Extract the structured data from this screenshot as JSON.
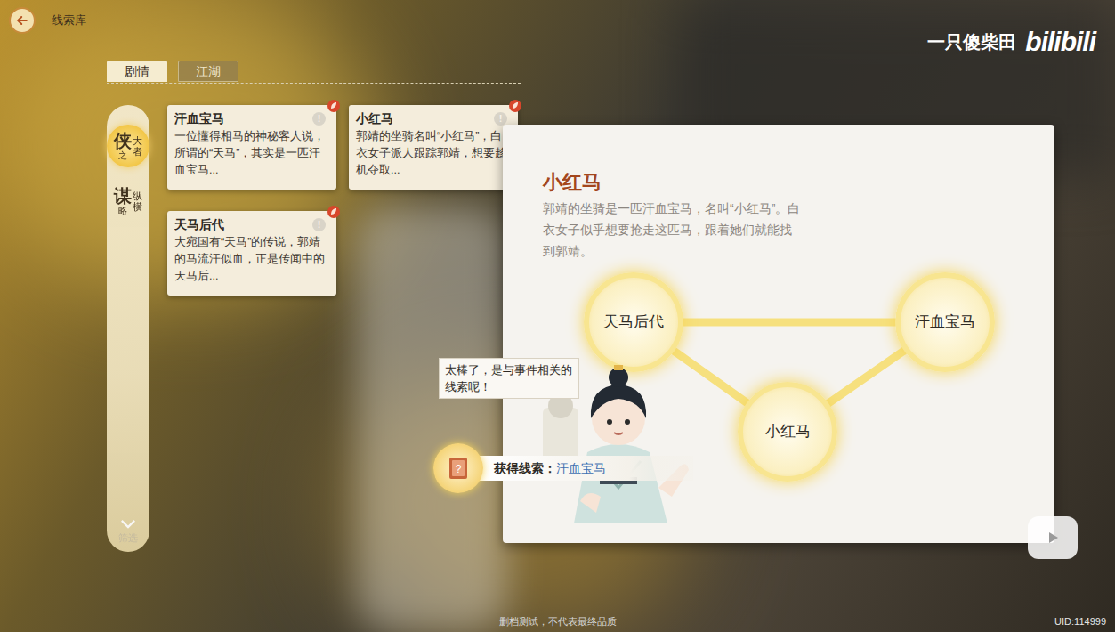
{
  "header": {
    "title": "线索库"
  },
  "watermark": {
    "author": "一只傻柴田",
    "logo": "bilibili"
  },
  "tabs": [
    {
      "label": "剧情",
      "selected": true
    },
    {
      "label": "江湖",
      "selected": false
    }
  ],
  "chapters": [
    {
      "main": "侠",
      "sub": "之",
      "side": "大者",
      "selected": true
    },
    {
      "main": "谋",
      "sub": "略",
      "side": "纵横",
      "selected": false
    }
  ],
  "filter": {
    "label": "筛选"
  },
  "clues": [
    {
      "title": "汗血宝马",
      "desc": "一位懂得相马的神秘客人说，所谓的“天马”，其实是一匹汗血宝马...",
      "new": true,
      "hint": "!"
    },
    {
      "title": "小红马",
      "desc": "郭靖的坐骑名叫“小红马”，白衣女子派人跟踪郭靖，想要趁机夺取...",
      "new": true,
      "hint": "!"
    },
    {
      "title": "天马后代",
      "desc": "大宛国有“天马”的传说，郭靖的马流汗似血，正是传闻中的天马后...",
      "new": true,
      "hint": "!"
    }
  ],
  "detail": {
    "title": "小红马",
    "desc": "郭靖的坐骑是一匹汗血宝马，名叫“小红马”。白衣女子似乎想要抢走这匹马，跟着她们就能找到郭靖。"
  },
  "graph": {
    "nodes": [
      {
        "label": "天马后代"
      },
      {
        "label": "汗血宝马"
      },
      {
        "label": "小红马"
      }
    ],
    "edges": [
      {
        "from": 0,
        "to": 1
      },
      {
        "from": 0,
        "to": 2
      },
      {
        "from": 2,
        "to": 1
      }
    ]
  },
  "guide": {
    "speech": "太棒了，是与事件相关的线索呢！"
  },
  "toast": {
    "prefix": "获得线索：",
    "clue": "汗血宝马"
  },
  "footer": {
    "notice": "删档测试，不代表最终品质",
    "uid": "UID:114999"
  }
}
